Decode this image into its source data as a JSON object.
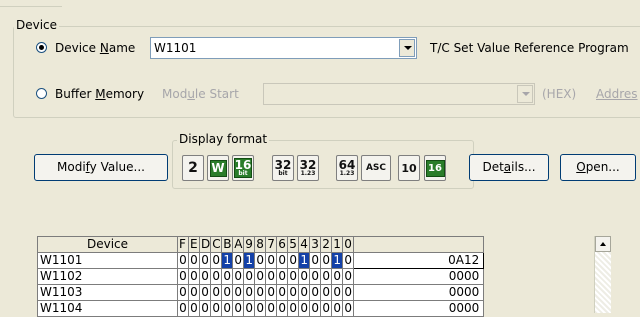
{
  "device_group": {
    "title": "Device",
    "device_name_radio": {
      "label_pre": "Device ",
      "label_ul": "N",
      "label_post": "ame",
      "selected": true
    },
    "device_name_value": "W1101",
    "tc_label": "T/C Set Value Reference Program",
    "buffer_radio": {
      "label_pre": "Buffer ",
      "label_ul": "M",
      "label_post": "emory",
      "selected": false
    },
    "module_start_label_pre": "Mod",
    "module_start_label_ul": "u",
    "module_start_label_post": "le Start",
    "module_start_value": "",
    "hex_label": "(HEX)",
    "address_label_pre": "Addres"
  },
  "display_format": {
    "title": "Display format",
    "buttons": [
      {
        "name": "bits-2",
        "text": "2"
      },
      {
        "name": "word",
        "text": "W"
      },
      {
        "name": "16bit",
        "top": "16",
        "bottom": "bit"
      },
      {
        "name": "32bit",
        "top": "32",
        "bottom": "bit"
      },
      {
        "name": "32bit-float",
        "top": "32",
        "bottom": "1.23"
      },
      {
        "name": "64bit-float",
        "top": "64",
        "bottom": "1.23"
      },
      {
        "name": "ascii",
        "text": "ASC"
      },
      {
        "name": "dec-10",
        "text": "10"
      },
      {
        "name": "hex-16",
        "text": "16"
      }
    ]
  },
  "buttons": {
    "modify_pre": "Modi",
    "modify_ul": "f",
    "modify_post": "y Value...",
    "details_pre": "Det",
    "details_ul": "a",
    "details_post": "ils...",
    "open_ul": "O",
    "open_post": "pen..."
  },
  "table": {
    "header_device": "Device",
    "bit_headers": [
      "F",
      "E",
      "D",
      "C",
      "B",
      "A",
      "9",
      "8",
      "7",
      "6",
      "5",
      "4",
      "3",
      "2",
      "1",
      "0"
    ],
    "value_header": "",
    "rows": [
      {
        "device": "W1101",
        "bits": [
          "0",
          "0",
          "0",
          "0",
          "1",
          "0",
          "1",
          "0",
          "0",
          "0",
          "0",
          "1",
          "0",
          "0",
          "1",
          "0"
        ],
        "value": "0A12"
      },
      {
        "device": "W1102",
        "bits": [
          "0",
          "0",
          "0",
          "0",
          "0",
          "0",
          "0",
          "0",
          "0",
          "0",
          "0",
          "0",
          "0",
          "0",
          "0",
          "0"
        ],
        "value": "0000"
      },
      {
        "device": "W1103",
        "bits": [
          "0",
          "0",
          "0",
          "0",
          "0",
          "0",
          "0",
          "0",
          "0",
          "0",
          "0",
          "0",
          "0",
          "0",
          "0",
          "0"
        ],
        "value": "0000"
      },
      {
        "device": "W1104",
        "bits": [
          "0",
          "0",
          "0",
          "0",
          "0",
          "0",
          "0",
          "0",
          "0",
          "0",
          "0",
          "0",
          "0",
          "0",
          "0",
          "0"
        ],
        "value": "0000"
      }
    ]
  },
  "colors": {
    "window_bg": "#ece9d8",
    "bit_on": "#1441a8",
    "format_green": "#2a7d2a"
  }
}
